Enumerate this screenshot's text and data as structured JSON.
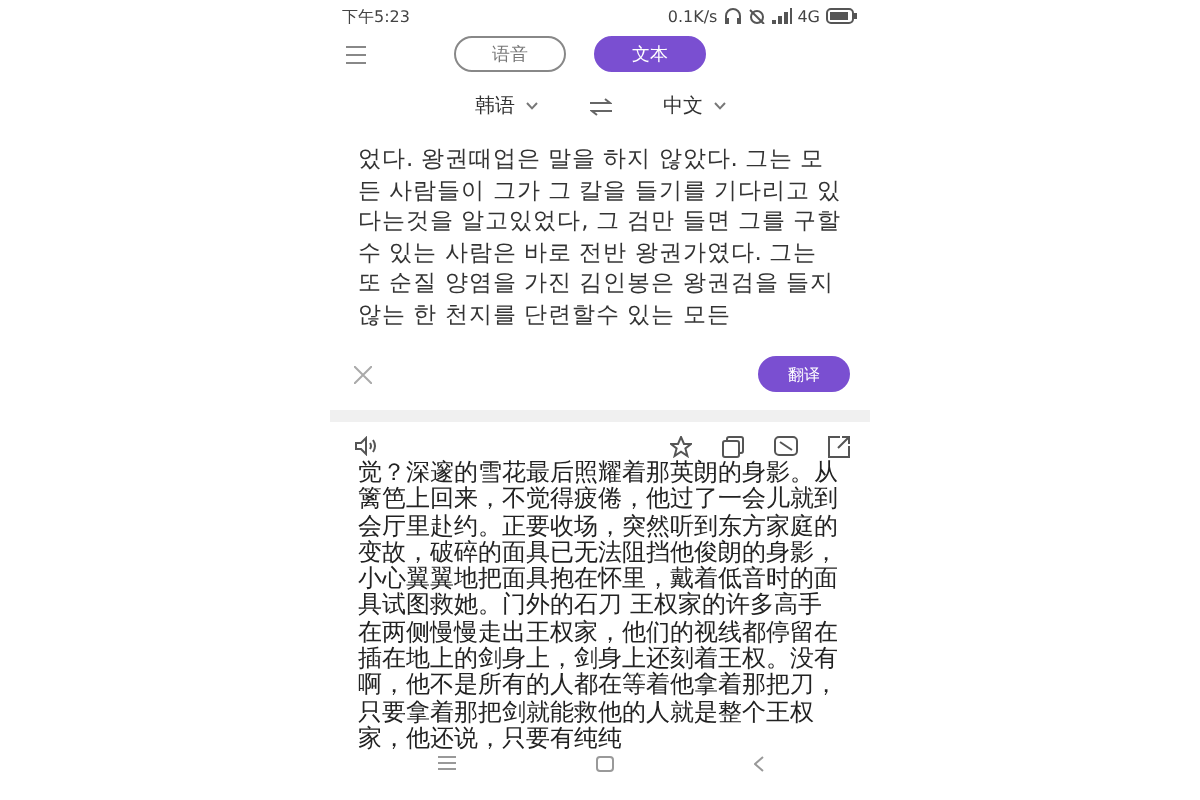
{
  "status_bar": {
    "time": "下午5:23",
    "network_speed": "0.1K/s",
    "network_type": "4G"
  },
  "tabs": [
    {
      "label": "语音",
      "selected": false
    },
    {
      "label": "文本",
      "selected": true
    }
  ],
  "languages": {
    "source": "韩语",
    "target": "中文"
  },
  "source_text": "었다.  왕권때업은 말을 하지 않았다.  그는 모든 사람들이 그가 그 칼을 들기를 기다리고 있다는것을 알고있었다, 그 검만 들면 그를 구할수 있는 사람은 바로 전반 왕권가였다. 그는 또 순질 양염을 가진 김인봉은 왕권검을 들지 않는 한 천지를 단련할수 있는 모든",
  "translate_button": "翻译",
  "translation": "觉？深邃的雪花最后照耀着那英朗的身影。从篱笆上回来，不觉得疲倦，他过了一会儿就到会厅里赴约。正要收场，突然听到东方家庭的变故，破碎的面具已无法阻挡他俊朗的身影，小心翼翼地把面具抱在怀里，戴着低音时的面具试图救她。门外的石刀 王权家的许多高手在两侧慢慢走出王权家，他们的视线都停留在插在地上的剑身上，剑身上还刻着王权。没有啊，他不是所有的人都在等着他拿着那把刀，只要拿着那把剑就能救他的人就是整个王权家，他还说，只要有纯纯"
}
